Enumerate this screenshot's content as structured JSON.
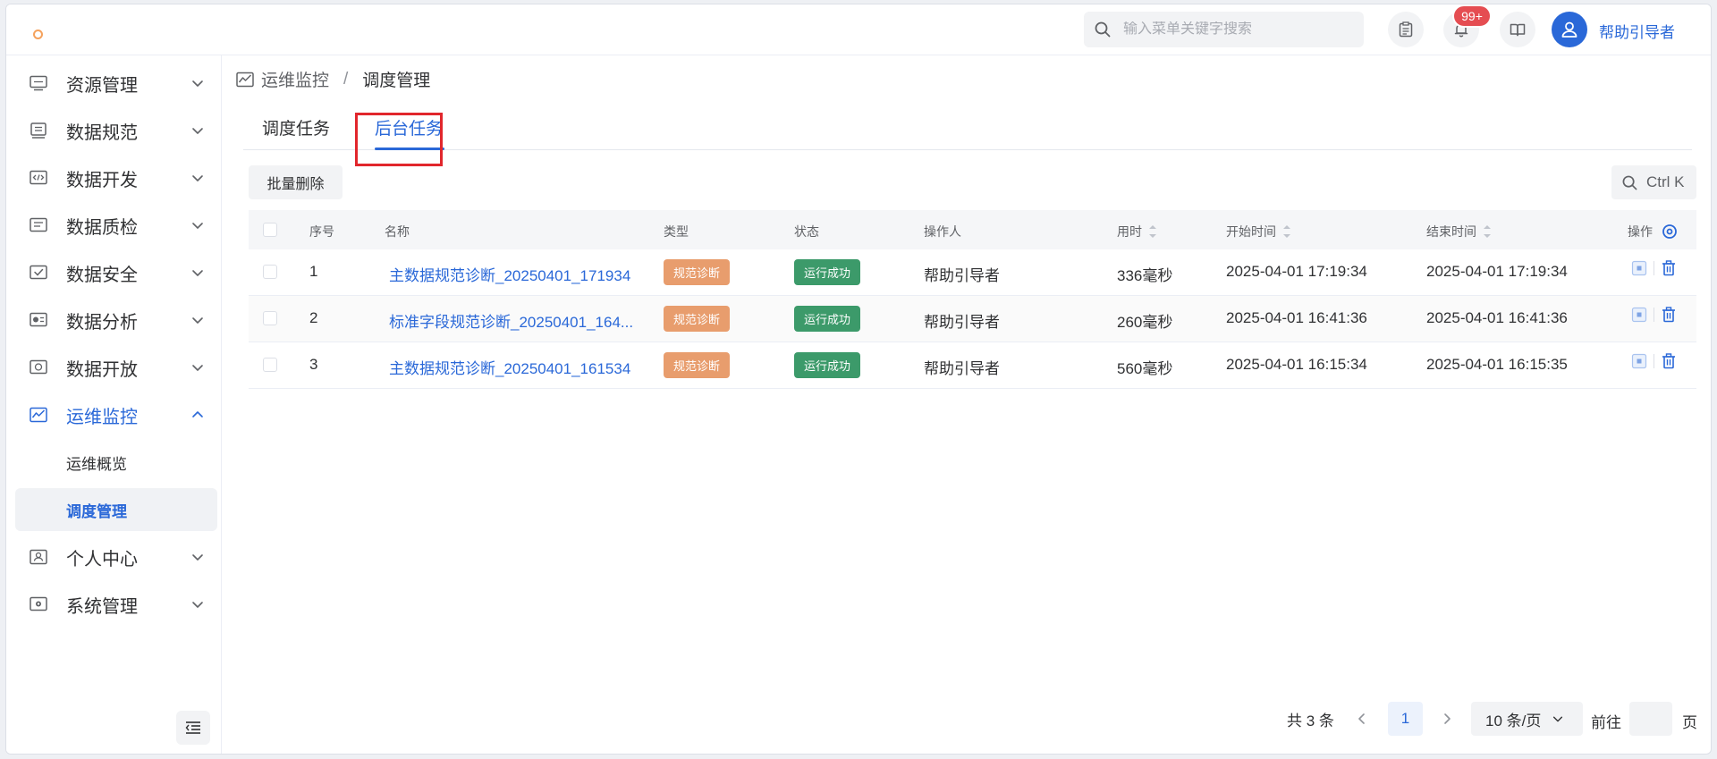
{
  "header": {
    "search_placeholder": "输入菜单关键字搜索",
    "notification_badge": "99+",
    "user_name": "帮助引导者"
  },
  "sidebar": {
    "items": [
      {
        "label": "资源管理",
        "icon": "server-icon"
      },
      {
        "label": "数据规范",
        "icon": "standard-icon"
      },
      {
        "label": "数据开发",
        "icon": "code-icon"
      },
      {
        "label": "数据质检",
        "icon": "quality-icon"
      },
      {
        "label": "数据安全",
        "icon": "security-icon"
      },
      {
        "label": "数据分析",
        "icon": "analysis-icon"
      },
      {
        "label": "数据开放",
        "icon": "open-icon"
      },
      {
        "label": "运维监控",
        "icon": "monitor-icon"
      },
      {
        "label": "个人中心",
        "icon": "user-card-icon"
      },
      {
        "label": "系统管理",
        "icon": "system-icon"
      }
    ],
    "sub_items": [
      "运维概览",
      "调度管理"
    ]
  },
  "breadcrumb": {
    "parent": "运维监控",
    "separator": "/",
    "current": "调度管理"
  },
  "tabs": [
    "调度任务",
    "后台任务"
  ],
  "toolbar": {
    "batch_delete": "批量删除",
    "shortcut": "Ctrl K"
  },
  "table": {
    "headers": {
      "index": "序号",
      "name": "名称",
      "type": "类型",
      "status": "状态",
      "operator": "操作人",
      "duration": "用时",
      "start": "开始时间",
      "end": "结束时间",
      "actions": "操作"
    },
    "rows": [
      {
        "index": "1",
        "name": "主数据规范诊断_20250401_171934",
        "type": "规范诊断",
        "status": "运行成功",
        "operator": "帮助引导者",
        "duration": "336毫秒",
        "start": "2025-04-01 17:19:34",
        "end": "2025-04-01 17:19:34"
      },
      {
        "index": "2",
        "name": "标准字段规范诊断_20250401_164...",
        "type": "规范诊断",
        "status": "运行成功",
        "operator": "帮助引导者",
        "duration": "260毫秒",
        "start": "2025-04-01 16:41:36",
        "end": "2025-04-01 16:41:36"
      },
      {
        "index": "3",
        "name": "主数据规范诊断_20250401_161534",
        "type": "规范诊断",
        "status": "运行成功",
        "operator": "帮助引导者",
        "duration": "560毫秒",
        "start": "2025-04-01 16:15:34",
        "end": "2025-04-01 16:15:35"
      }
    ]
  },
  "pagination": {
    "total": "共 3 条",
    "current_page": "1",
    "page_size": "10 条/页",
    "goto": "前往",
    "page_unit": "页"
  },
  "colors": {
    "accent": "#2a68d8",
    "type_tag": "#e89d6d",
    "status_tag": "#3c9a6a",
    "badge": "#e54d52",
    "highlight": "#e1262c"
  }
}
